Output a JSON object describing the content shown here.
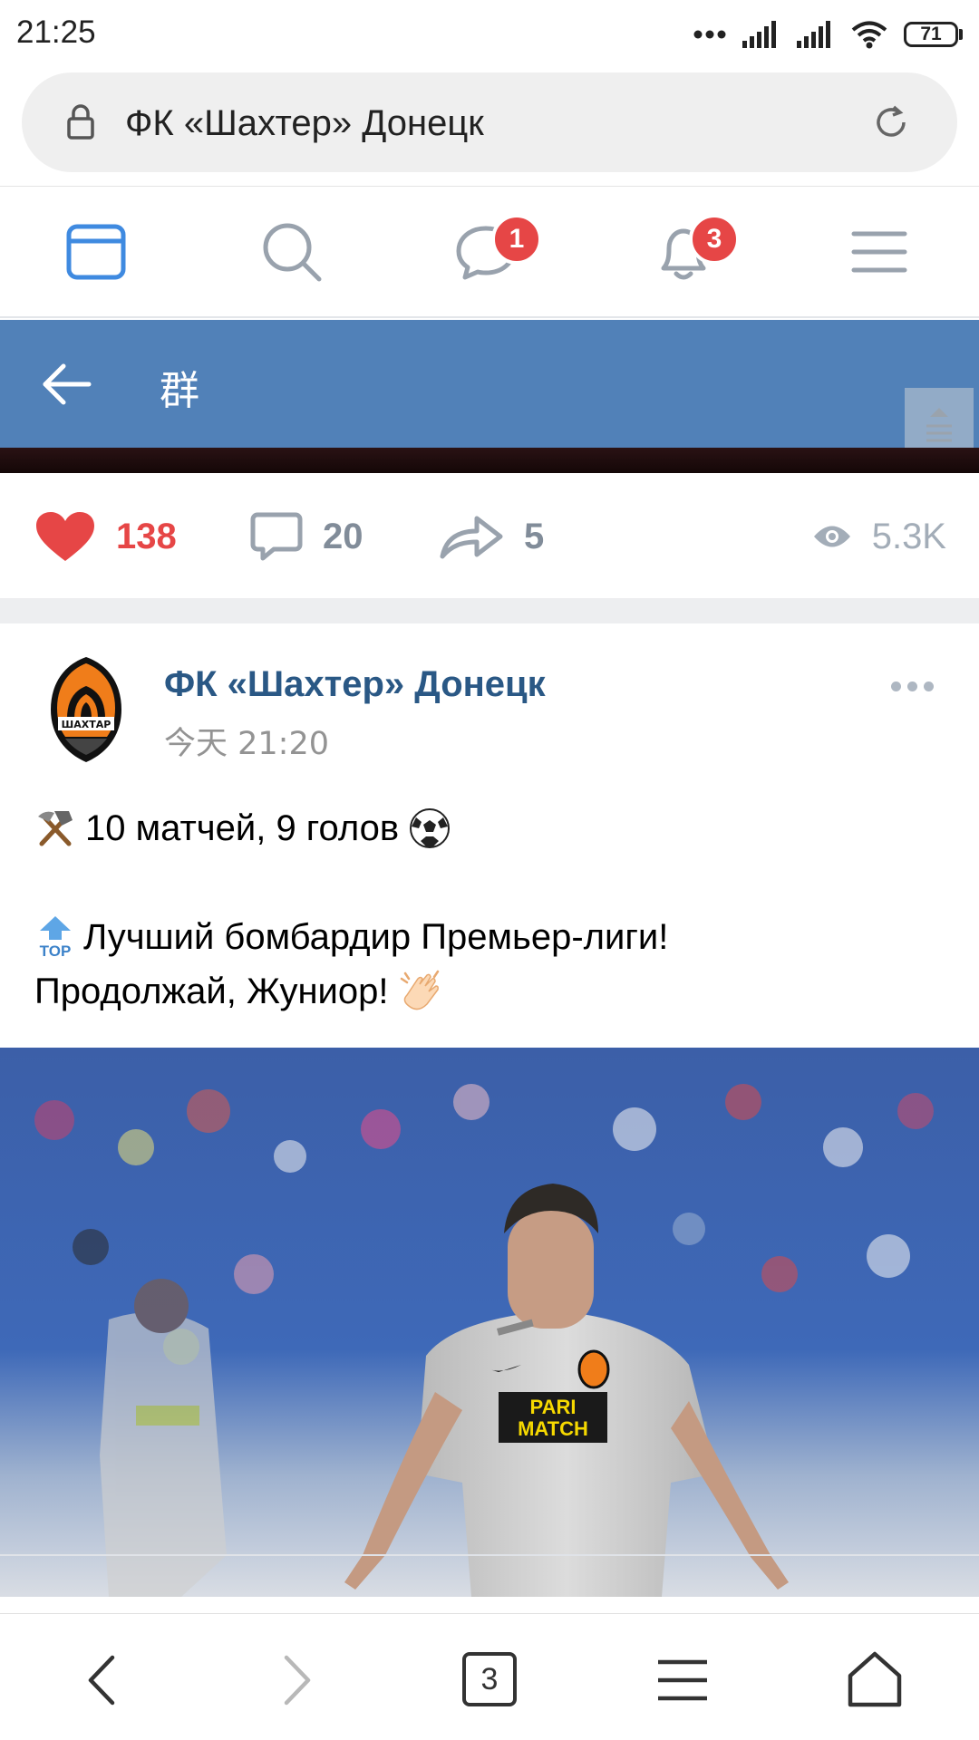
{
  "status_bar": {
    "time": "21:25",
    "battery": "71",
    "icons": [
      "dots-icon",
      "signal-icon",
      "signal-icon",
      "wifi-icon",
      "battery-icon"
    ]
  },
  "browser": {
    "url_title": "ФК «Шахтер» Донецк",
    "lock_icon": "lock-icon",
    "reload_icon": "reload-icon"
  },
  "vk_nav": {
    "items": [
      {
        "name": "feed",
        "icon": "newsfeed-icon",
        "active": true
      },
      {
        "name": "search",
        "icon": "search-icon"
      },
      {
        "name": "messages",
        "icon": "message-icon",
        "badge": "1"
      },
      {
        "name": "notifications",
        "icon": "bell-icon",
        "badge": "3"
      },
      {
        "name": "menu",
        "icon": "hamburger-icon"
      }
    ]
  },
  "header": {
    "title": "群",
    "back_icon": "back-arrow-icon"
  },
  "reactions": {
    "likes": "138",
    "comments": "20",
    "shares": "5",
    "views": "5.3K"
  },
  "post": {
    "author": "ФК «Шахтер» Донецк",
    "time": "今天 21:20",
    "line1": "10 матчей, 9 голов",
    "line2": "Лучший бомбардир Премьер-лиги!",
    "line3": "Продолжай, Жуниор!",
    "emoji_top_label": "TOP",
    "photo_texts": {
      "sponsor_line1": "PARI",
      "sponsor_line2": "MATCH"
    }
  },
  "bottom_bar": {
    "tab_count": "3",
    "icons": [
      "back-icon",
      "forward-icon",
      "tabs-icon",
      "menu-icon",
      "home-icon"
    ]
  },
  "colors": {
    "vk_blue": "#5181b8",
    "accent_blue": "#3f8ae0",
    "like_red": "#e64646",
    "author_blue": "#2a5885"
  }
}
